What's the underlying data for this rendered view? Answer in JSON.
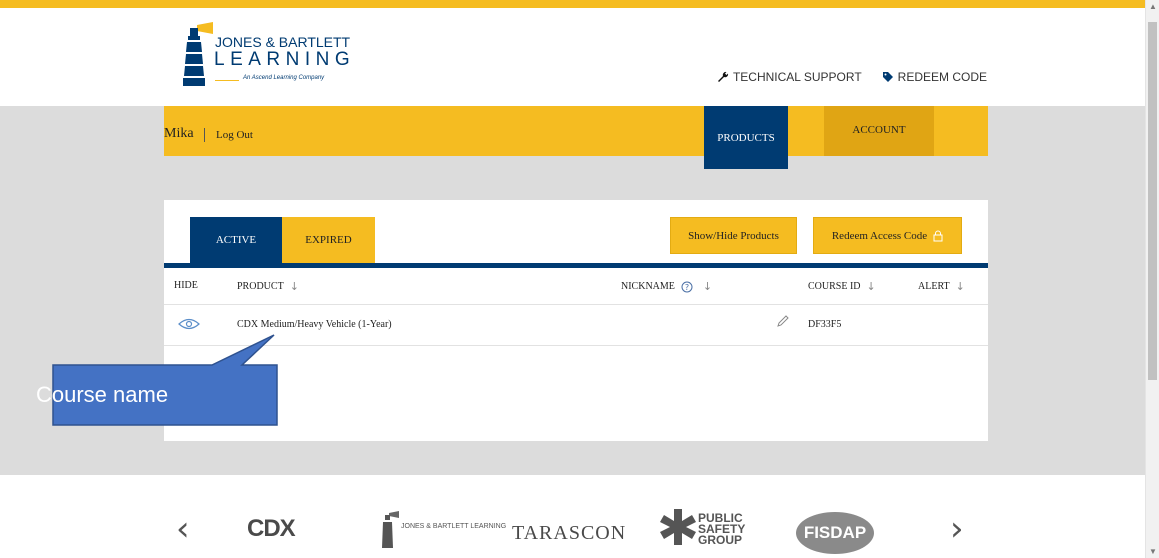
{
  "header": {
    "logo": {
      "line1": "JONES & BARTLETT",
      "line2": "LEARNING",
      "tagline": "An Ascend Learning Company"
    },
    "links": [
      {
        "label": "TECHNICAL SUPPORT",
        "icon": "wrench-icon"
      },
      {
        "label": "REDEEM CODE",
        "icon": "tag-icon"
      }
    ]
  },
  "nav": {
    "user": "Mika",
    "logout": "Log Out",
    "products": "PRODUCTS",
    "account": "ACCOUNT"
  },
  "panel": {
    "tabs": [
      {
        "label": "ACTIVE",
        "active": true
      },
      {
        "label": "EXPIRED",
        "active": false
      }
    ],
    "show_hide_label": "Show/Hide Products",
    "redeem_label": "Redeem Access Code",
    "columns": {
      "hide": "HIDE",
      "product": "PRODUCT",
      "nickname": "NICKNAME",
      "course_id": "COURSE ID",
      "alert": "ALERT"
    },
    "rows": [
      {
        "product": "CDX Medium/Heavy Vehicle (1-Year)",
        "nickname": "",
        "course_id": "DF33F5",
        "alert": ""
      }
    ]
  },
  "annotation": {
    "label": "Course name"
  },
  "footer": {
    "brands": [
      {
        "name": "CDX"
      },
      {
        "name": "JONES & BARTLETT LEARNING"
      },
      {
        "name": "TARASCON"
      },
      {
        "name": "PUBLIC SAFETY GROUP"
      },
      {
        "name": "FISDAP"
      }
    ]
  },
  "colors": {
    "navy": "#003b72",
    "gold": "#f5bc21",
    "gold_dark": "#e0a514",
    "callout": "#4472c4",
    "gray": "#dcdcdc"
  }
}
